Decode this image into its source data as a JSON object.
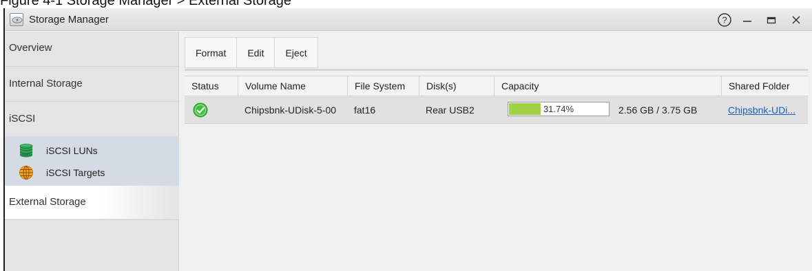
{
  "caption": {
    "text": "Figure 4-1 Storage Manager > External Storage"
  },
  "window": {
    "title": "Storage Manager",
    "icon": "storage-manager-icon",
    "controls": {
      "help": "?",
      "minimize": "–",
      "maximize": "▭",
      "close": "✕"
    }
  },
  "sidebar": {
    "items": [
      {
        "label": "Overview"
      },
      {
        "label": "Internal Storage"
      },
      {
        "label": "iSCSI"
      },
      {
        "label": "External Storage",
        "active": true
      }
    ],
    "iscsi_children": [
      {
        "label": "iSCSI LUNs",
        "icon": "database-icon"
      },
      {
        "label": "iSCSI Targets",
        "icon": "globe-icon"
      }
    ]
  },
  "toolbar": {
    "format_label": "Format",
    "edit_label": "Edit",
    "eject_label": "Eject"
  },
  "table": {
    "columns": [
      "Status",
      "Volume Name",
      "File System",
      "Disk(s)",
      "Capacity",
      "Shared Folder"
    ],
    "rows": [
      {
        "status": "ok",
        "volume_name": "Chipsbnk-UDisk-5-00",
        "file_system": "fat16",
        "disks": "Rear USB2",
        "capacity_percent": 31.74,
        "capacity_percent_label": "31.74%",
        "capacity_text": "2.56 GB / 3.75 GB",
        "shared_folder": "Chipsbnk-UDi..."
      }
    ]
  },
  "colors": {
    "status_ok": "#3fbf3f",
    "capacity_fill": "#9ed143",
    "link": "#1a5fb4",
    "sidebar_sub_bg": "#d5dbe4"
  }
}
